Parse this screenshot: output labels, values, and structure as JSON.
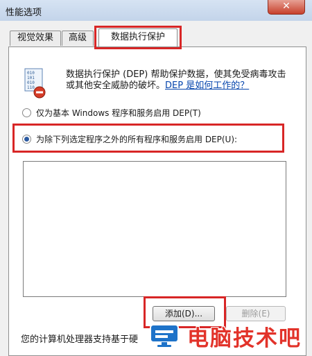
{
  "window": {
    "title": "性能选项",
    "close_glyph": "✕"
  },
  "tabs": [
    {
      "label": "视觉效果",
      "active": false
    },
    {
      "label": "高级",
      "active": false
    },
    {
      "label": "数据执行保护",
      "active": true
    }
  ],
  "dep": {
    "icon": "dep-shield-icon",
    "description": "数据执行保护 (DEP) 帮助保护数据，使其免受病毒攻击或其他安全威胁的破坏。",
    "help_link": "DEP 是如何工作的？"
  },
  "options": {
    "essential_only": {
      "label": "仅为基本 Windows 程序和服务启用 DEP(T)",
      "checked": false
    },
    "all_except": {
      "label": "为除下列选定程序之外的所有程序和服务启用 DEP(U):",
      "checked": true
    }
  },
  "buttons": {
    "add": "添加(D)...",
    "remove": "删除(E)"
  },
  "footer": {
    "text": "您的计算机处理器支持基于硬"
  },
  "watermark": {
    "text": "电脑技术吧",
    "logo": "monitor-logo-icon"
  },
  "colors": {
    "highlight": "#d82626",
    "link": "#0645ad"
  }
}
